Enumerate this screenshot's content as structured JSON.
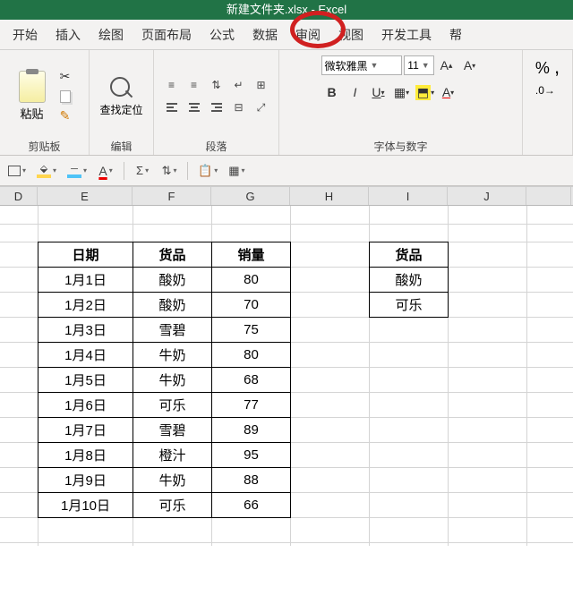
{
  "title": "新建文件夹.xlsx - Excel",
  "tabs": [
    "开始",
    "插入",
    "绘图",
    "页面布局",
    "公式",
    "数据",
    "审阅",
    "视图",
    "开发工具",
    "帮"
  ],
  "ribbon": {
    "clipboard": {
      "paste": "粘贴",
      "label": "剪贴板"
    },
    "find": {
      "button": "查找定位",
      "label": "编辑"
    },
    "paragraph": {
      "label": "段落"
    },
    "font": {
      "name": "微软雅黑",
      "size": "11",
      "bold": "B",
      "italic": "I",
      "underline": "U",
      "label": "字体与数字"
    },
    "number": {
      "percent": "%",
      "comma": ","
    }
  },
  "qat": {
    "sigma": "Σ",
    "fontA": "A"
  },
  "columns": {
    "D": "D",
    "E": "E",
    "F": "F",
    "G": "G",
    "H": "H",
    "I": "I",
    "J": "J",
    "K": ""
  },
  "table1": {
    "headers": [
      "日期",
      "货品",
      "销量"
    ],
    "rows": [
      [
        "1月1日",
        "酸奶",
        "80"
      ],
      [
        "1月2日",
        "酸奶",
        "70"
      ],
      [
        "1月3日",
        "雪碧",
        "75"
      ],
      [
        "1月4日",
        "牛奶",
        "80"
      ],
      [
        "1月5日",
        "牛奶",
        "68"
      ],
      [
        "1月6日",
        "可乐",
        "77"
      ],
      [
        "1月7日",
        "雪碧",
        "89"
      ],
      [
        "1月8日",
        "橙汁",
        "95"
      ],
      [
        "1月9日",
        "牛奶",
        "88"
      ],
      [
        "1月10日",
        "可乐",
        "66"
      ]
    ]
  },
  "table2": {
    "headers": [
      "货品"
    ],
    "rows": [
      [
        "酸奶"
      ],
      [
        "可乐"
      ]
    ]
  }
}
